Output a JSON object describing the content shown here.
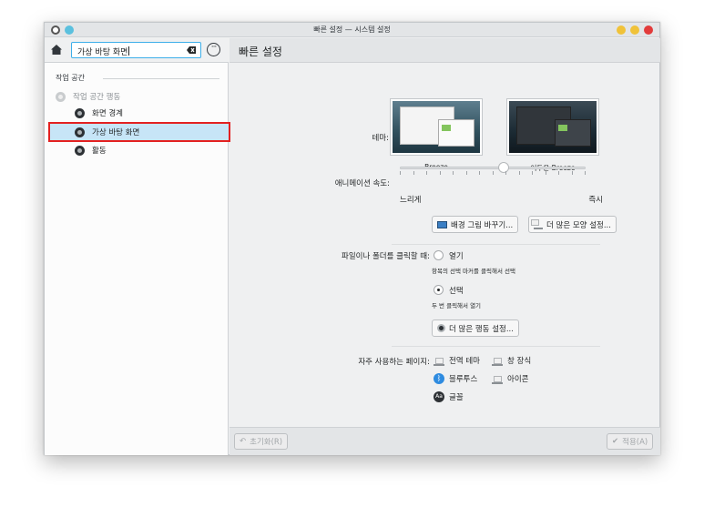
{
  "window": {
    "title": "빠른 설정 — 시스템 설정"
  },
  "sidebar": {
    "search_value": "가상 바탕 화면",
    "category": "작업 공간",
    "items": [
      {
        "label": "작업 공간 행동"
      },
      {
        "label": "화면 경계"
      },
      {
        "label": "가상 바탕 화면"
      },
      {
        "label": "활동"
      }
    ]
  },
  "main": {
    "title": "빠른 설정",
    "theme_label": "테마:",
    "themes": [
      {
        "name": "Breeze"
      },
      {
        "name": "어두운 Breeze"
      }
    ],
    "animation_label": "애니메이션 속도:",
    "animation_slow": "느리게",
    "animation_fast": "즉시",
    "animation_level": 0.56,
    "wallpaper_button": "배경 그림 바꾸기...",
    "more_appearance_button": "더 많은 모양 설정...",
    "click_label": "파일이나 폴더를 클릭할 때:",
    "click_open": "열기",
    "click_open_hint": "항목의 선택 마커를 클릭해서 선택",
    "click_select": "선택",
    "click_select_hint": "두 번 클릭해서 열기",
    "more_behavior_button": "더 많은 행동 설정...",
    "frequent_label": "자주 사용하는 페이지:",
    "frequent": {
      "global_theme": "전역 테마",
      "window_decor": "창 장식",
      "bluetooth": "블루투스",
      "icons": "아이콘",
      "fonts": "글꼴"
    }
  },
  "footer": {
    "reset": "초기화(R)",
    "apply": "적용(A)"
  }
}
